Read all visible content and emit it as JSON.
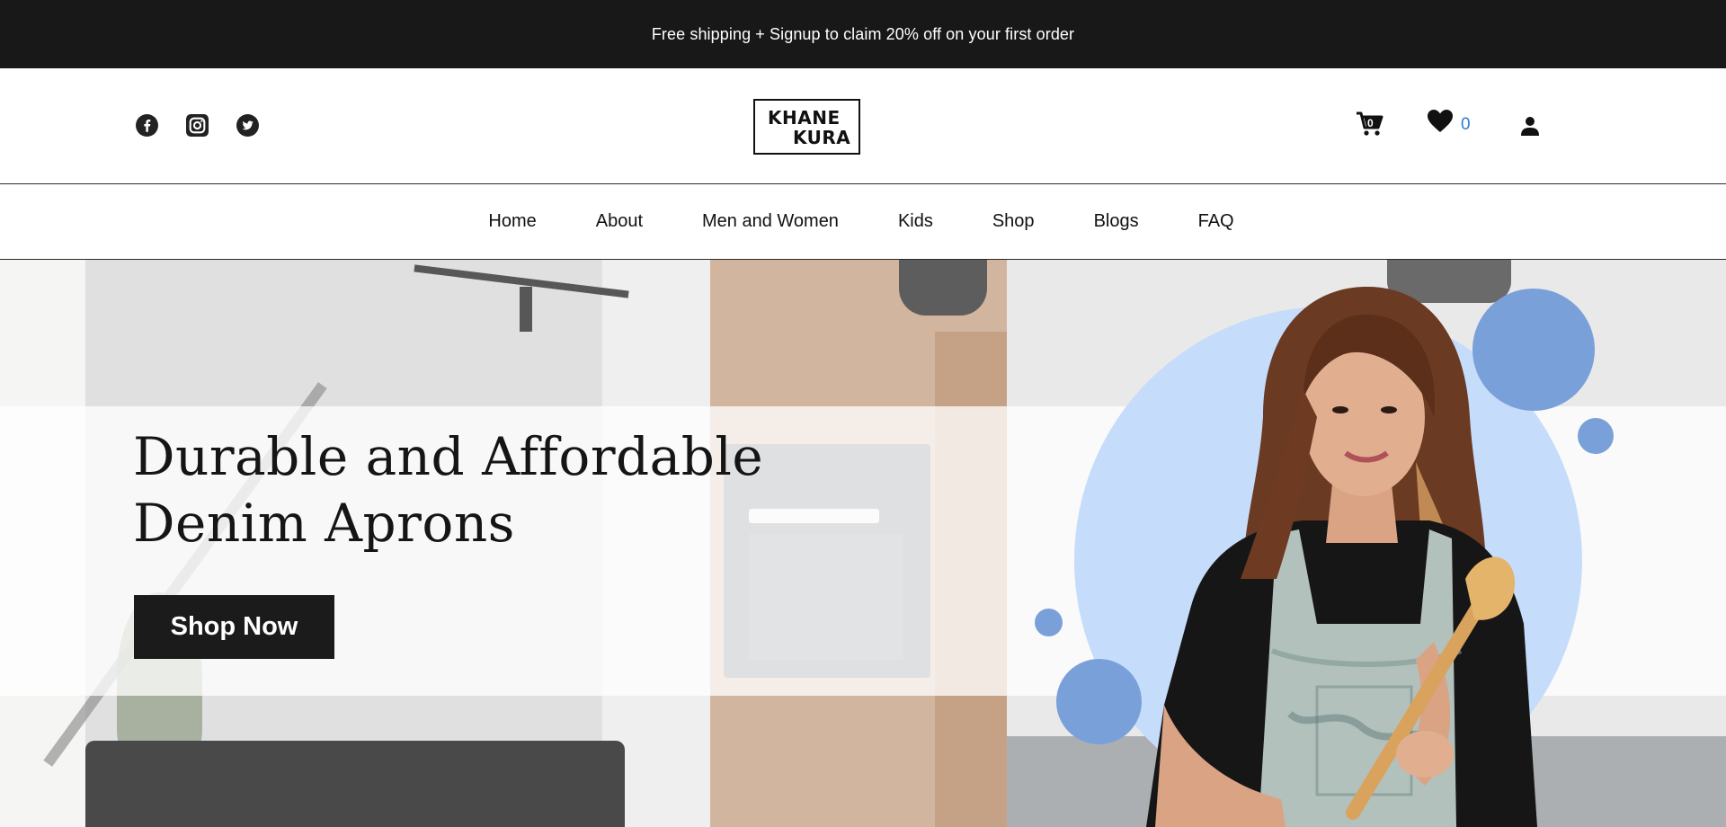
{
  "announcement": {
    "text": "Free shipping + Signup to claim 20% off on your first order"
  },
  "header": {
    "socials": [
      {
        "icon": "facebook-icon"
      },
      {
        "icon": "instagram-icon"
      },
      {
        "icon": "twitter-icon"
      }
    ],
    "logo": {
      "line1": "KHANE",
      "line2": "KURA"
    },
    "cart": {
      "icon": "cart-icon",
      "count": "0"
    },
    "wishlist": {
      "icon": "heart-icon",
      "count": "0",
      "count_color": "#2a7fd4"
    },
    "account": {
      "icon": "user-icon"
    }
  },
  "nav": {
    "items": [
      {
        "label": "Home"
      },
      {
        "label": "About"
      },
      {
        "label": "Men and Women"
      },
      {
        "label": "Kids"
      },
      {
        "label": "Shop"
      },
      {
        "label": "Blogs"
      },
      {
        "label": "FAQ"
      }
    ]
  },
  "hero": {
    "title_line1": "Durable and Affordable",
    "title_line2": "Denim Aprons",
    "cta_label": "Shop Now",
    "accent_light": "#c6dcfb",
    "accent": "#7aa0da"
  }
}
